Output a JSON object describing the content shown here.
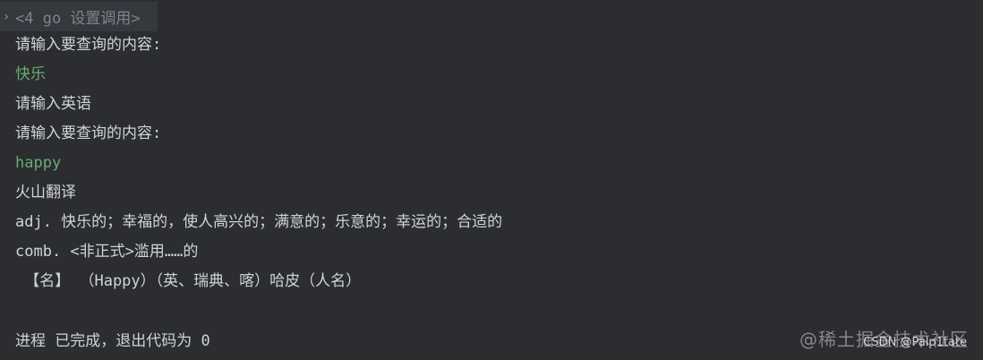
{
  "console": {
    "header": "<4 go 设置调用>",
    "lines": [
      {
        "text": "请输入要查询的内容:",
        "style": "normal"
      },
      {
        "text": "快乐",
        "style": "input"
      },
      {
        "text": "请输入英语",
        "style": "normal"
      },
      {
        "text": "请输入要查询的内容:",
        "style": "normal"
      },
      {
        "text": "happy",
        "style": "input"
      },
      {
        "text": "火山翻译",
        "style": "normal"
      },
      {
        "text": "adj. 快乐的；幸福的，使人高兴的；满意的；乐意的；幸运的；合适的",
        "style": "normal"
      },
      {
        "text": "comb. <非正式>滥用……的",
        "style": "normal"
      },
      {
        "text": " 【名】 （Happy）（英、瑞典、喀）哈皮（人名）",
        "style": "normal"
      },
      {
        "text": "",
        "style": "normal"
      },
      {
        "text": "进程 已完成，退出代码为 0",
        "style": "normal"
      }
    ]
  },
  "watermark": {
    "main": "@稀土掘金技术社区",
    "sub": "CSDN @Palp1tate"
  },
  "colors": {
    "background": "#2b2d30",
    "text": "#d0d3d9",
    "input": "#6aab73",
    "header_bg": "#35383d"
  }
}
